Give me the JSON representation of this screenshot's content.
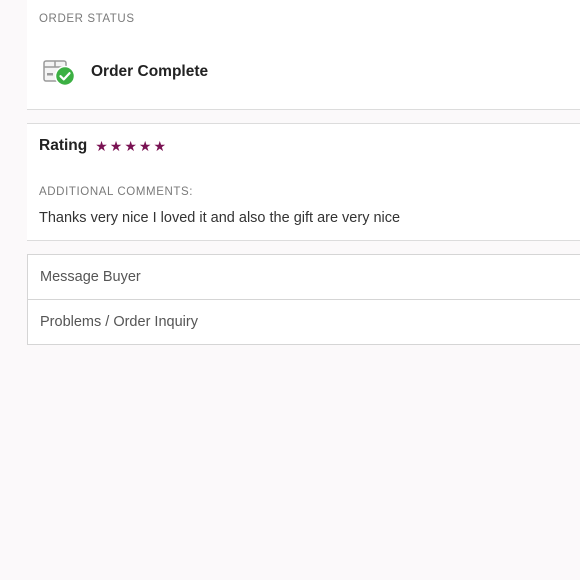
{
  "order_status": {
    "heading": "ORDER STATUS",
    "status": "Order Complete",
    "icon": "box-check-icon",
    "check_color": "#3cb043"
  },
  "review": {
    "rating_label": "Rating",
    "rating": 5,
    "max_rating": 5,
    "star_color": "#7a1253",
    "comments_heading": "ADDITIONAL COMMENTS:",
    "comments": "Thanks very nice I loved it and also the gift are very nice"
  },
  "actions": {
    "message_buyer": "Message Buyer",
    "order_inquiry": "Problems / Order Inquiry"
  }
}
